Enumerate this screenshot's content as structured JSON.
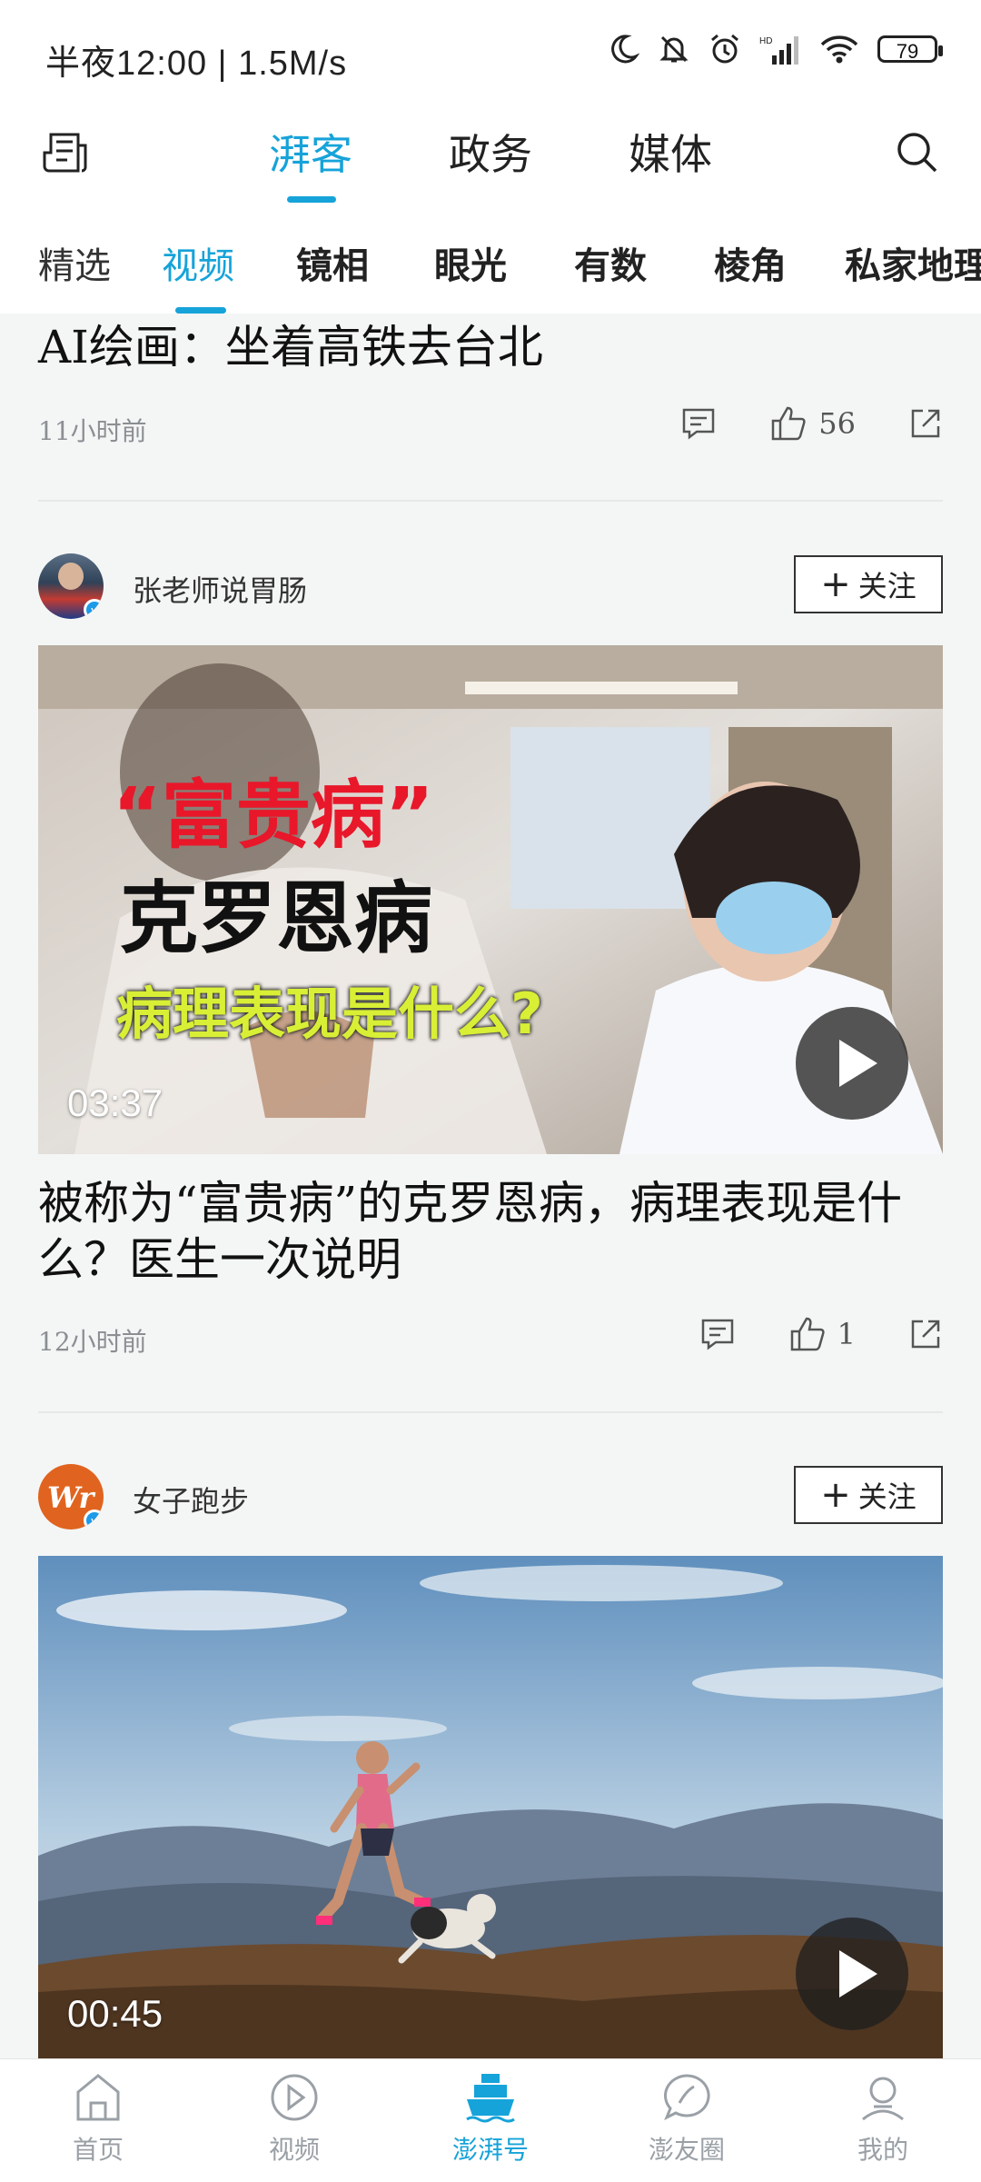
{
  "status_bar": {
    "time": "半夜12:00 | 1.5M/s",
    "battery": "79"
  },
  "top_nav": {
    "tabs": [
      {
        "label": "湃客",
        "active": true
      },
      {
        "label": "政务",
        "active": false
      },
      {
        "label": "媒体",
        "active": false
      }
    ]
  },
  "sub_nav": {
    "tabs": [
      {
        "label": "精选",
        "active": false
      },
      {
        "label": "视频",
        "active": true
      },
      {
        "label": "镜相"
      },
      {
        "label": "眼光"
      },
      {
        "label": "有数"
      },
      {
        "label": "棱角"
      },
      {
        "label": "私家地理"
      }
    ]
  },
  "feed": {
    "item0": {
      "title": "AI绘画：坐着高铁去台北",
      "time": "11小时前",
      "likes": "56"
    },
    "item1": {
      "author": "张老师说胃肠",
      "follow": "关注",
      "thumb_line1": "“富贵病”",
      "thumb_line2": "克罗恩病",
      "thumb_line3": "病理表现是什么?",
      "duration": "03:37",
      "title": "被称为“富贵病”的克罗恩病，病理表现是什么？医生一次说明",
      "time": "12小时前",
      "likes": "1"
    },
    "item2": {
      "author": "女子跑步",
      "follow": "关注",
      "duration": "00:45"
    }
  },
  "bottom_nav": {
    "items": [
      {
        "label": "首页",
        "icon": "home-icon"
      },
      {
        "label": "视频",
        "icon": "video-play-icon"
      },
      {
        "label": "澎湃号",
        "icon": "boat-icon",
        "active": true
      },
      {
        "label": "澎友圈",
        "icon": "chat-bubble-icon"
      },
      {
        "label": "我的",
        "icon": "profile-icon"
      }
    ]
  },
  "colors": {
    "accent": "#16a3d9",
    "thumb_red": "#e8172a",
    "thumb_yellow": "#d8ef35"
  }
}
